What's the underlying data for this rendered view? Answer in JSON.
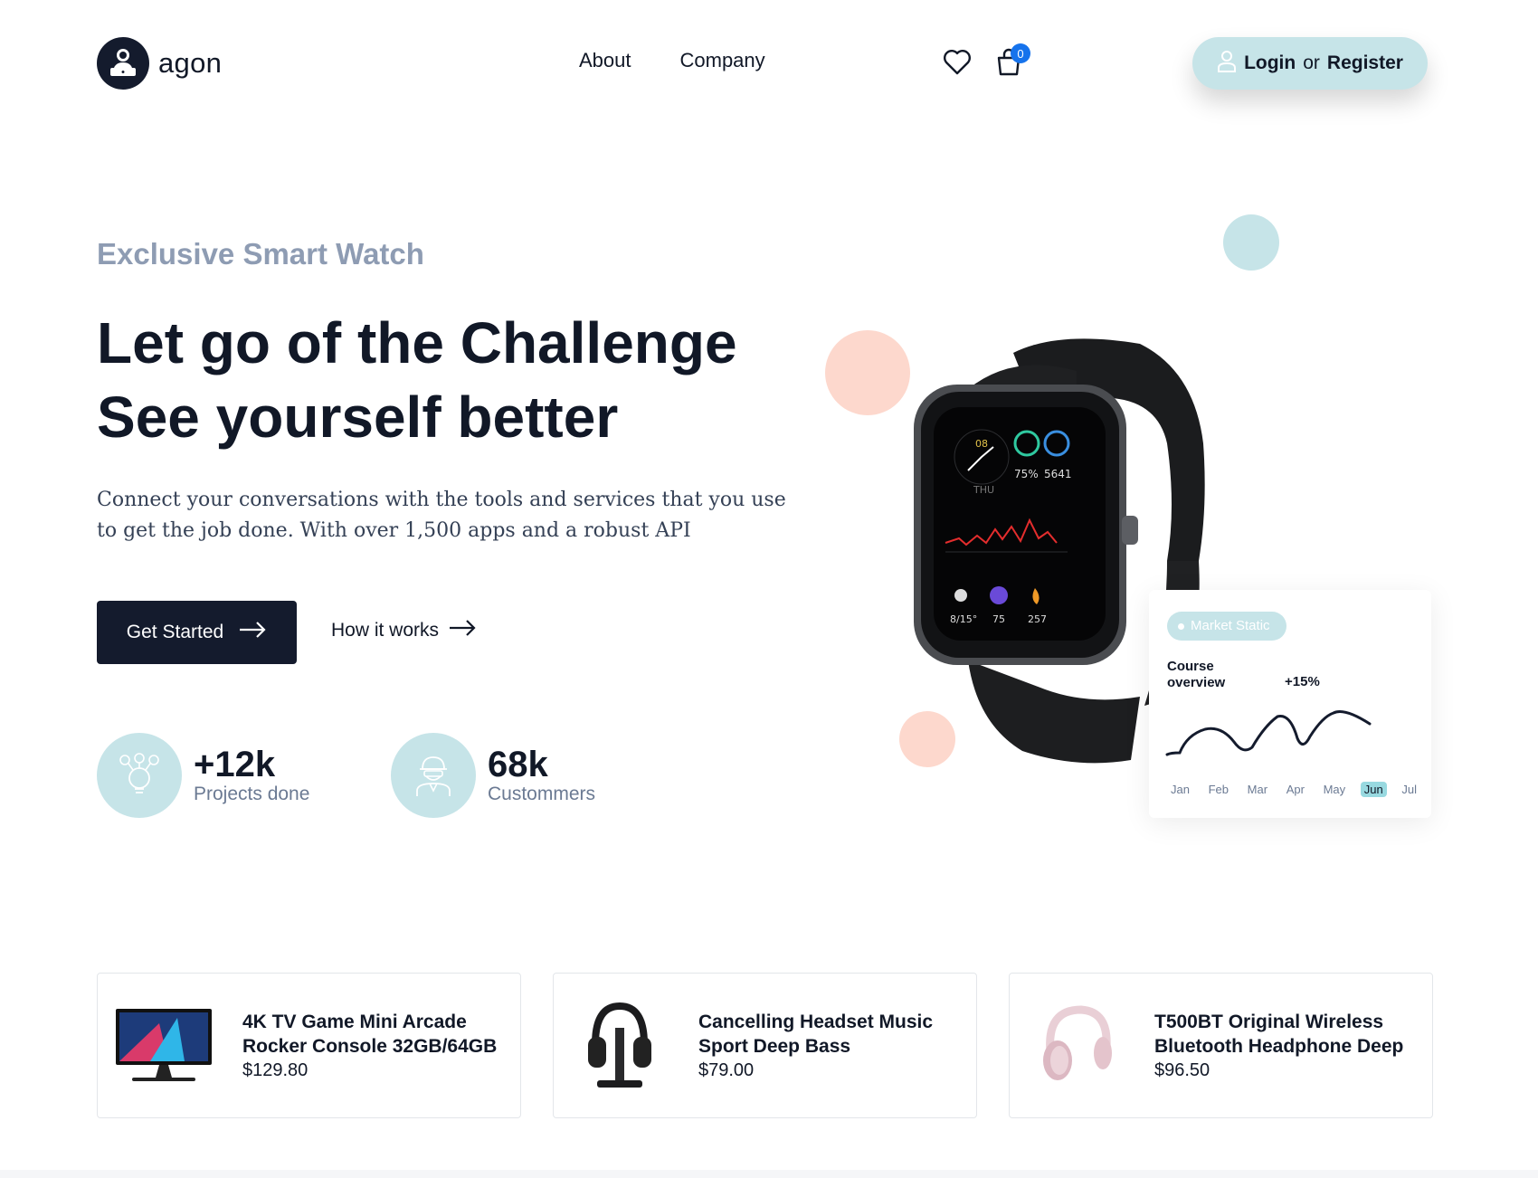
{
  "brand": {
    "name": "agon",
    "logo_icon": "user-laptop-icon"
  },
  "nav": {
    "items": [
      "About",
      "Company"
    ]
  },
  "header": {
    "wishlist_icon": "heart-icon",
    "cart_icon": "shopping-bag-icon",
    "cart_count": "0",
    "login_label": "Login",
    "or_label": "or",
    "register_label": "Register",
    "user_icon": "user-icon"
  },
  "hero": {
    "eyebrow": "Exclusive Smart Watch",
    "headline_line1": "Let go of the Challenge",
    "headline_line2": "See yourself better",
    "lead": "Connect your conversations with the tools and services that you use to get the job done. With over 1,500 apps and a robust API",
    "cta_primary": "Get Started",
    "cta_secondary": "How it works"
  },
  "stats": [
    {
      "value": "+12k",
      "label": "Projects done",
      "icon": "lightbulb-gear-icon"
    },
    {
      "value": "68k",
      "label": "Custommers",
      "icon": "worker-icon"
    }
  ],
  "market_card": {
    "pill": "Market Static",
    "title": "Course overview",
    "change": "+15%",
    "months": [
      "Jan",
      "Feb",
      "Mar",
      "Apr",
      "May",
      "Jun",
      "Jul"
    ],
    "active_month": "Jun"
  },
  "watch": {
    "time": "08",
    "day": "THU",
    "power": "75%",
    "steps": "5641",
    "weather": "8/15°",
    "pai": "75",
    "calories": "257"
  },
  "products": [
    {
      "name": "4K TV Game Mini Arcade Rocker Console 32GB/64GB",
      "price": "$129.80",
      "image": "monitor-image"
    },
    {
      "name": "Cancelling Headset Music Sport Deep Bass",
      "price": "$79.00",
      "image": "headphones-black-image"
    },
    {
      "name": "T500BT Original Wireless Bluetooth Headphone Deep",
      "price": "$96.50",
      "image": "headphones-pink-image"
    }
  ],
  "colors": {
    "primary": "#141b2d",
    "accent": "#c6e4e8",
    "peach": "#fdd8cd",
    "badge": "#1673ec",
    "muted": "#8e9cb3"
  }
}
